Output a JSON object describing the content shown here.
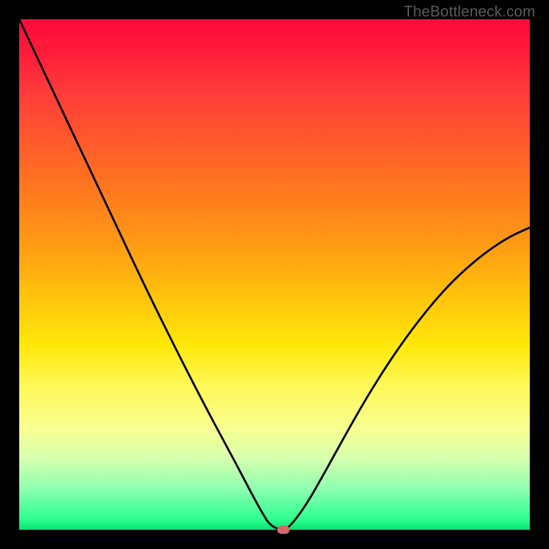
{
  "watermark": "TheBottleneck.com",
  "chart_data": {
    "type": "line",
    "title": "",
    "xlabel": "",
    "ylabel": "",
    "xlim": [
      0,
      1
    ],
    "ylim": [
      0,
      1
    ],
    "background_gradient_note": "red_top_to_green_bottom",
    "series": [
      {
        "name": "curve",
        "x": [
          0.0,
          0.04,
          0.08,
          0.12,
          0.16,
          0.2,
          0.24,
          0.28,
          0.32,
          0.36,
          0.4,
          0.42,
          0.44,
          0.46,
          0.475,
          0.49,
          0.51,
          0.525,
          0.56,
          0.6,
          0.64,
          0.68,
          0.72,
          0.76,
          0.8,
          0.84,
          0.88,
          0.92,
          0.96,
          1.0
        ],
        "y": [
          1.0,
          0.915,
          0.83,
          0.745,
          0.66,
          0.575,
          0.49,
          0.408,
          0.328,
          0.25,
          0.175,
          0.138,
          0.1,
          0.062,
          0.035,
          0.01,
          0.0,
          0.0,
          0.045,
          0.115,
          0.188,
          0.258,
          0.322,
          0.38,
          0.432,
          0.478,
          0.516,
          0.548,
          0.574,
          0.592
        ]
      }
    ],
    "marker": {
      "x": 0.518,
      "y": 0.0,
      "color": "#d46a6a"
    }
  }
}
